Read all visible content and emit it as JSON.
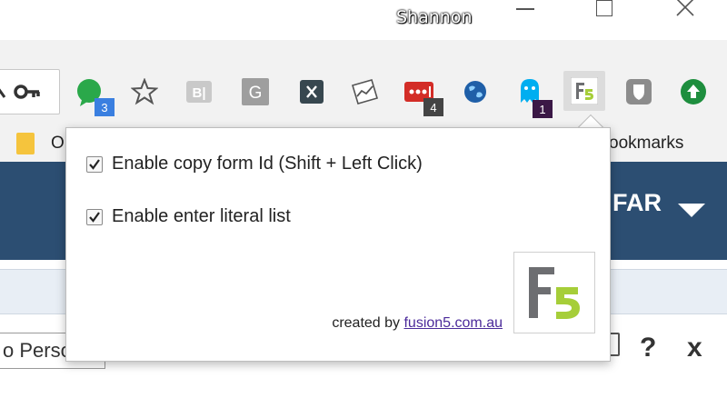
{
  "window": {
    "user_name": "Shannon",
    "controls": [
      "minimize",
      "maximize",
      "close"
    ]
  },
  "toolbar": {
    "omnibox_icons": [
      "search-icon",
      "key-icon"
    ],
    "extensions": [
      {
        "name": "green-chat-icon",
        "badge": "3",
        "badge_color": "#3a7fe0"
      },
      {
        "name": "star-icon",
        "badge": ""
      },
      {
        "name": "bi-icon",
        "badge": ""
      },
      {
        "name": "g-icon",
        "badge": ""
      },
      {
        "name": "x-icon",
        "badge": ""
      },
      {
        "name": "chart-icon",
        "badge": ""
      },
      {
        "name": "lastpass-icon",
        "badge": "4",
        "badge_color": "#444444"
      },
      {
        "name": "globe-icon",
        "badge": ""
      },
      {
        "name": "ghostery-icon",
        "badge": "1",
        "badge_color": "#3b1846"
      },
      {
        "name": "f5-icon",
        "badge": "",
        "active": true
      },
      {
        "name": "shield-icon",
        "badge": ""
      },
      {
        "name": "upload-icon",
        "badge": ""
      }
    ]
  },
  "bookmarks": {
    "left_fragment": "O",
    "right_fragment": "ookmarks"
  },
  "page": {
    "header_text": "FAR",
    "search_fragment": "o Perso",
    "help_label": "?",
    "close_label": "x"
  },
  "popup": {
    "option_copy_id": {
      "label": "Enable copy form Id (Shift + Left Click)",
      "checked": true
    },
    "option_literal_list": {
      "label": "Enable enter literal list",
      "checked": true
    },
    "credit_prefix": "created by",
    "credit_link": "fusion5.com.au"
  },
  "colors": {
    "header_blue": "#2c4e72",
    "link_purple": "#4b2a9a",
    "f5_green": "#a6ce39",
    "f5_grey": "#6d6e71"
  }
}
